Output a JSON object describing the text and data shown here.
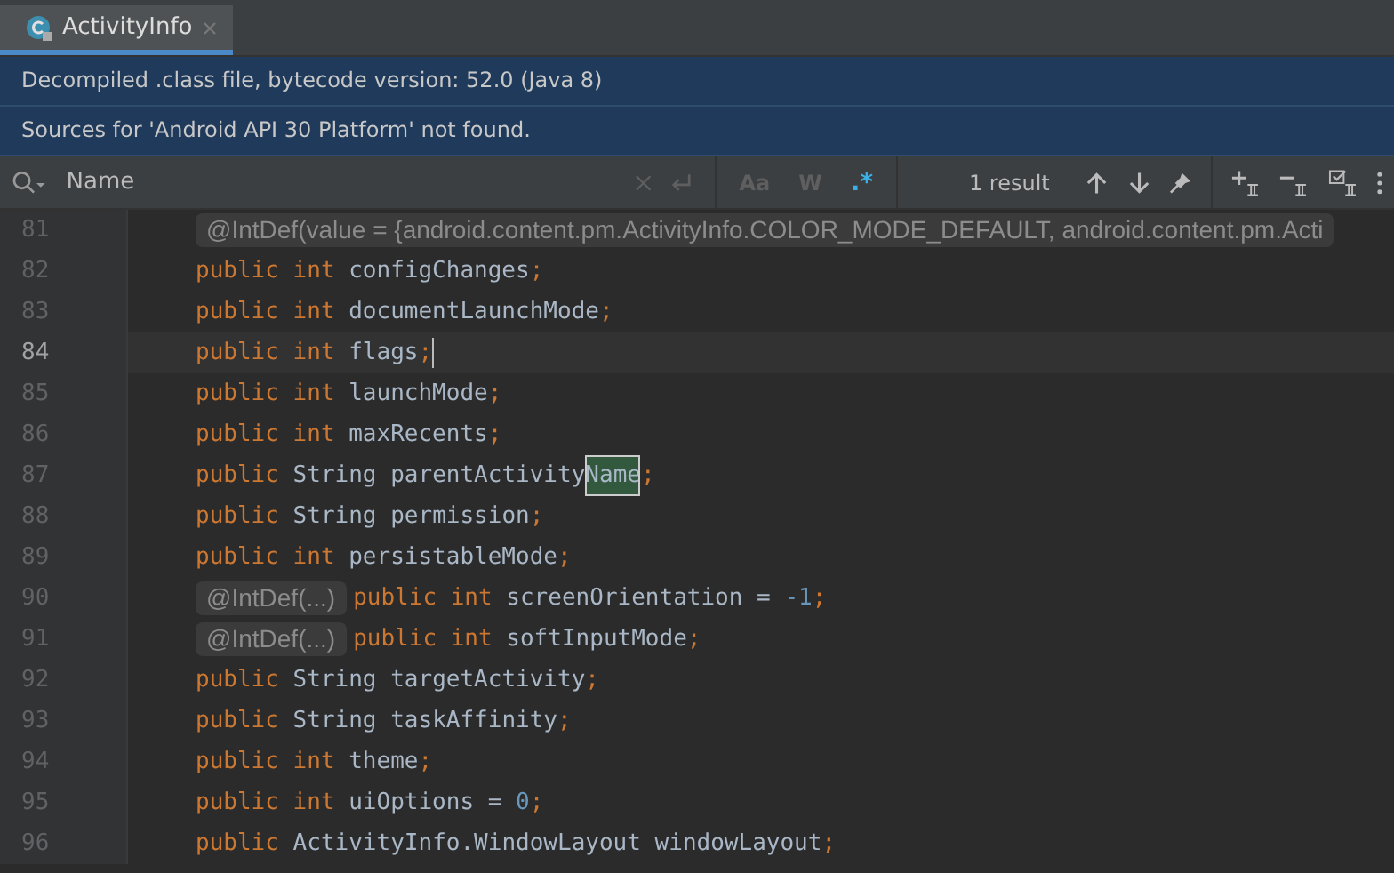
{
  "tabs": [
    {
      "label": "ActivityInfo",
      "selected": true
    }
  ],
  "banners": [
    "Decompiled .class file, bytecode version: 52.0 (Java 8)",
    "Sources for 'Android API 30 Platform' not found."
  ],
  "search": {
    "value": "Name",
    "toggles": [
      {
        "label": "Aa",
        "selected": false
      },
      {
        "label": "W",
        "selected": false
      },
      {
        "label": ".*",
        "selected": true
      }
    ],
    "result": "1 result"
  },
  "lines": [
    {
      "number": "81",
      "current": false,
      "caret": false,
      "parts": [
        {
          "kind": "annotation",
          "text": "@IntDef(value = {android.content.pm.ActivityInfo.COLOR_MODE_DEFAULT, android.content.pm.Acti"
        }
      ]
    },
    {
      "number": "82",
      "current": false,
      "caret": false,
      "parts": [
        {
          "kind": "keyword",
          "text": "public int "
        },
        {
          "kind": "plain",
          "text": "configChanges"
        },
        {
          "kind": "keyword",
          "text": ";"
        }
      ]
    },
    {
      "number": "83",
      "current": false,
      "caret": false,
      "parts": [
        {
          "kind": "keyword",
          "text": "public int "
        },
        {
          "kind": "plain",
          "text": "documentLaunchMode"
        },
        {
          "kind": "keyword",
          "text": ";"
        }
      ]
    },
    {
      "number": "84",
      "current": true,
      "caret": true,
      "parts": [
        {
          "kind": "keyword",
          "text": "public int "
        },
        {
          "kind": "plain",
          "text": "flags"
        },
        {
          "kind": "keyword",
          "text": ";"
        }
      ]
    },
    {
      "number": "85",
      "current": false,
      "caret": false,
      "parts": [
        {
          "kind": "keyword",
          "text": "public int "
        },
        {
          "kind": "plain",
          "text": "launchMode"
        },
        {
          "kind": "keyword",
          "text": ";"
        }
      ]
    },
    {
      "number": "86",
      "current": false,
      "caret": false,
      "parts": [
        {
          "kind": "keyword",
          "text": "public int "
        },
        {
          "kind": "plain",
          "text": "maxRecents"
        },
        {
          "kind": "keyword",
          "text": ";"
        }
      ]
    },
    {
      "number": "87",
      "current": false,
      "caret": false,
      "parts": [
        {
          "kind": "keyword",
          "text": "public "
        },
        {
          "kind": "plain",
          "text": "String parentActivity"
        },
        {
          "kind": "match",
          "text": "Name"
        },
        {
          "kind": "keyword",
          "text": ";"
        }
      ]
    },
    {
      "number": "88",
      "current": false,
      "caret": false,
      "parts": [
        {
          "kind": "keyword",
          "text": "public "
        },
        {
          "kind": "plain",
          "text": "String permission"
        },
        {
          "kind": "keyword",
          "text": ";"
        }
      ]
    },
    {
      "number": "89",
      "current": false,
      "caret": false,
      "parts": [
        {
          "kind": "keyword",
          "text": "public int "
        },
        {
          "kind": "plain",
          "text": "persistableMode"
        },
        {
          "kind": "keyword",
          "text": ";"
        }
      ]
    },
    {
      "number": "90",
      "current": false,
      "caret": false,
      "parts": [
        {
          "kind": "annotation",
          "text": "@IntDef(...)"
        },
        {
          "kind": "keyword",
          "text": "public int "
        },
        {
          "kind": "plain",
          "text": "screenOrientation = "
        },
        {
          "kind": "number",
          "text": "-1"
        },
        {
          "kind": "keyword",
          "text": ";"
        }
      ]
    },
    {
      "number": "91",
      "current": false,
      "caret": false,
      "parts": [
        {
          "kind": "annotation",
          "text": "@IntDef(...)"
        },
        {
          "kind": "keyword",
          "text": "public int "
        },
        {
          "kind": "plain",
          "text": "softInputMode"
        },
        {
          "kind": "keyword",
          "text": ";"
        }
      ]
    },
    {
      "number": "92",
      "current": false,
      "caret": false,
      "parts": [
        {
          "kind": "keyword",
          "text": "public "
        },
        {
          "kind": "plain",
          "text": "String targetActivity"
        },
        {
          "kind": "keyword",
          "text": ";"
        }
      ]
    },
    {
      "number": "93",
      "current": false,
      "caret": false,
      "parts": [
        {
          "kind": "keyword",
          "text": "public "
        },
        {
          "kind": "plain",
          "text": "String taskAffinity"
        },
        {
          "kind": "keyword",
          "text": ";"
        }
      ]
    },
    {
      "number": "94",
      "current": false,
      "caret": false,
      "parts": [
        {
          "kind": "keyword",
          "text": "public int "
        },
        {
          "kind": "plain",
          "text": "theme"
        },
        {
          "kind": "keyword",
          "text": ";"
        }
      ]
    },
    {
      "number": "95",
      "current": false,
      "caret": false,
      "parts": [
        {
          "kind": "keyword",
          "text": "public int "
        },
        {
          "kind": "plain",
          "text": "uiOptions = "
        },
        {
          "kind": "number",
          "text": "0"
        },
        {
          "kind": "keyword",
          "text": ";"
        }
      ]
    },
    {
      "number": "96",
      "current": false,
      "caret": false,
      "parts": [
        {
          "kind": "keyword",
          "text": "public "
        },
        {
          "kind": "plain",
          "text": "ActivityInfo.WindowLayout windowLayout"
        },
        {
          "kind": "keyword",
          "text": ";"
        }
      ]
    }
  ]
}
